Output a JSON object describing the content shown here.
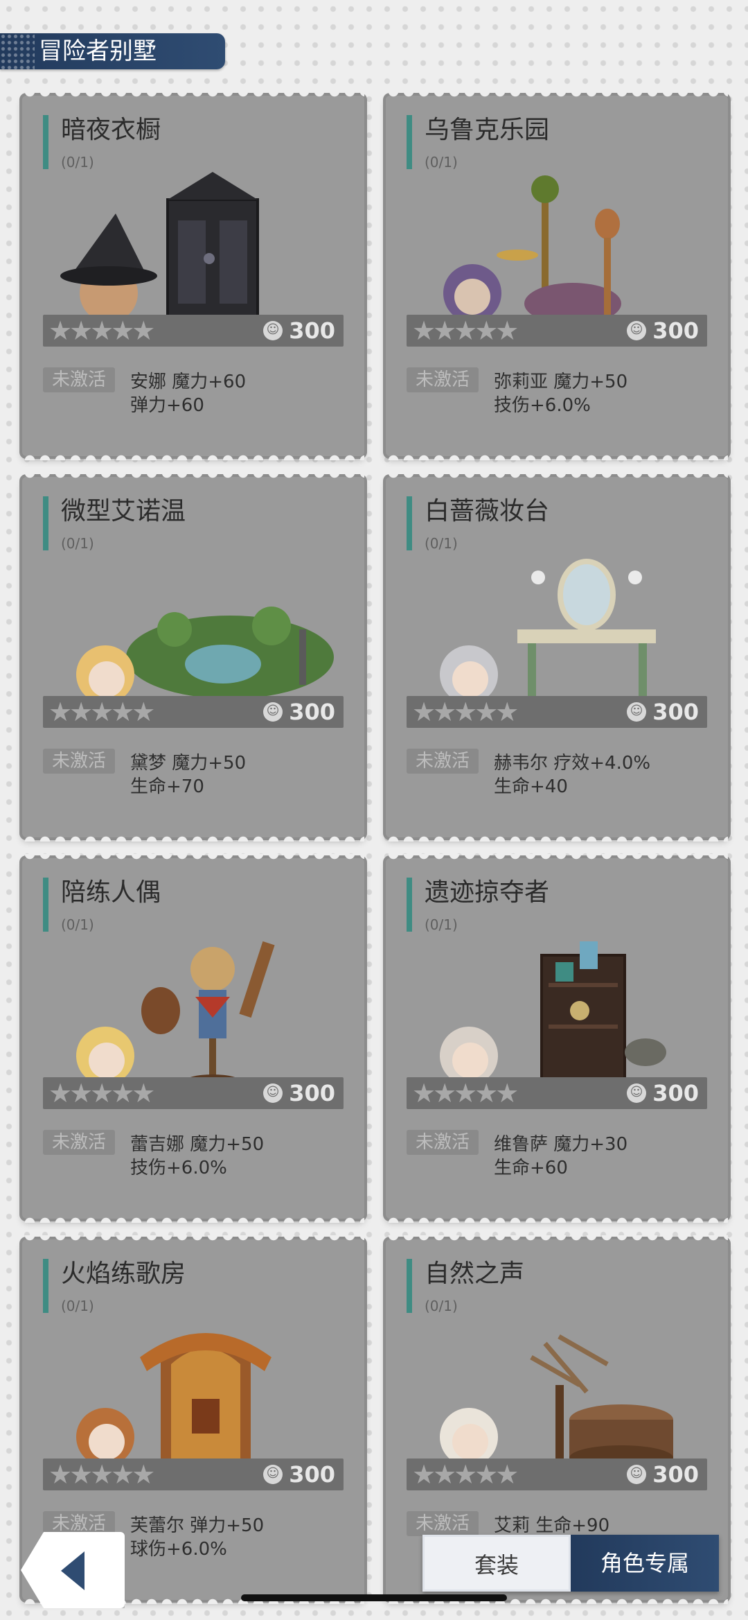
{
  "header": {
    "title": "冒险者别墅"
  },
  "cards": [
    {
      "title": "暗夜衣橱",
      "count": "(0/1)",
      "stars": "★★★★★",
      "cost": "300",
      "status": "未激活",
      "stat_line1": "安娜 魔力+60",
      "stat_line2": "弹力+60",
      "illustration": "witch-wardrobe"
    },
    {
      "title": "乌鲁克乐园",
      "count": "(0/1)",
      "stars": "★★★★★",
      "cost": "300",
      "status": "未激活",
      "stat_line1": "弥莉亚 魔力+50",
      "stat_line2": "技伤+6.0%",
      "illustration": "uruk-playground"
    },
    {
      "title": "微型艾诺温",
      "count": "(0/1)",
      "stars": "★★★★★",
      "cost": "300",
      "status": "未激活",
      "stat_line1": "黛梦 魔力+50",
      "stat_line2": "生命+70",
      "illustration": "mini-garden-pond"
    },
    {
      "title": "白蔷薇妆台",
      "count": "(0/1)",
      "stars": "★★★★★",
      "cost": "300",
      "status": "未激活",
      "stat_line1": "赫韦尔 疗效+4.0%",
      "stat_line2": "生命+40",
      "illustration": "rose-vanity"
    },
    {
      "title": "陪练人偶",
      "count": "(0/1)",
      "stars": "★★★★★",
      "cost": "300",
      "status": "未激活",
      "stat_line1": "蕾吉娜 魔力+50",
      "stat_line2": "技伤+6.0%",
      "illustration": "training-dummy"
    },
    {
      "title": "遗迹掠夺者",
      "count": "(0/1)",
      "stars": "★★★★★",
      "cost": "300",
      "status": "未激活",
      "stat_line1": "维鲁萨 魔力+30",
      "stat_line2": "生命+60",
      "illustration": "relic-shelf"
    },
    {
      "title": "火焰练歌房",
      "count": "(0/1)",
      "stars": "★★★★★",
      "cost": "300",
      "status": "未激活",
      "stat_line1": "芙蕾尔 弹力+50",
      "stat_line2": "球伤+6.0%",
      "illustration": "flame-booth"
    },
    {
      "title": "自然之声",
      "count": "(0/1)",
      "stars": "★★★★★",
      "cost": "300",
      "status": "未激活",
      "stat_line1": "艾莉 生命+90",
      "stat_line2": "",
      "illustration": "tree-stump"
    }
  ],
  "nav": {
    "tab_set": "套装",
    "tab_character": "角色专属",
    "back_icon": "back-arrow-icon"
  },
  "colors": {
    "accent": "#3f8c83",
    "navy": "#2f4c72",
    "card": "#9a9a9a",
    "rating_bar": "#6e6e6e"
  }
}
